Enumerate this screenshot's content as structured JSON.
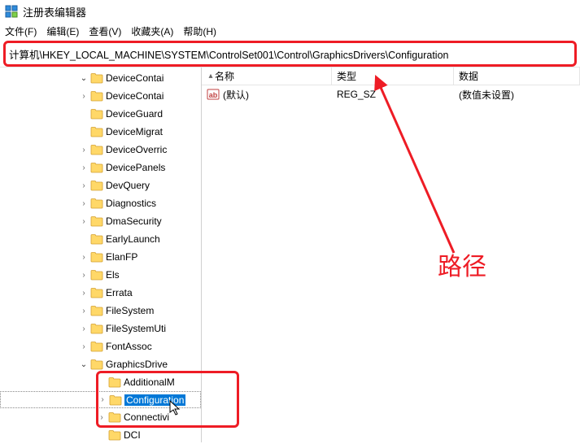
{
  "window": {
    "title": "注册表编辑器"
  },
  "menu": {
    "file": "文件(F)",
    "edit": "编辑(E)",
    "view": "查看(V)",
    "favorites": "收藏夹(A)",
    "help": "帮助(H)"
  },
  "address": "计算机\\HKEY_LOCAL_MACHINE\\SYSTEM\\ControlSet001\\Control\\GraphicsDrivers\\Configuration",
  "tree": [
    {
      "label": "DeviceContai",
      "expandable": true,
      "open": true,
      "indent": 1
    },
    {
      "label": "DeviceContai",
      "expandable": true,
      "open": false,
      "indent": 1
    },
    {
      "label": "DeviceGuard",
      "expandable": false,
      "open": false,
      "indent": 1
    },
    {
      "label": "DeviceMigrat",
      "expandable": false,
      "open": false,
      "indent": 1
    },
    {
      "label": "DeviceOverric",
      "expandable": true,
      "open": false,
      "indent": 1
    },
    {
      "label": "DevicePanels",
      "expandable": true,
      "open": false,
      "indent": 1
    },
    {
      "label": "DevQuery",
      "expandable": true,
      "open": false,
      "indent": 1
    },
    {
      "label": "Diagnostics",
      "expandable": true,
      "open": false,
      "indent": 1
    },
    {
      "label": "DmaSecurity",
      "expandable": true,
      "open": false,
      "indent": 1
    },
    {
      "label": "EarlyLaunch",
      "expandable": false,
      "open": false,
      "indent": 1
    },
    {
      "label": "ElanFP",
      "expandable": true,
      "open": false,
      "indent": 1
    },
    {
      "label": "Els",
      "expandable": true,
      "open": false,
      "indent": 1
    },
    {
      "label": "Errata",
      "expandable": true,
      "open": false,
      "indent": 1
    },
    {
      "label": "FileSystem",
      "expandable": true,
      "open": false,
      "indent": 1
    },
    {
      "label": "FileSystemUti",
      "expandable": true,
      "open": false,
      "indent": 1
    },
    {
      "label": "FontAssoc",
      "expandable": true,
      "open": false,
      "indent": 1
    },
    {
      "label": "GraphicsDrive",
      "expandable": true,
      "open": true,
      "indent": 1
    },
    {
      "label": "AdditionalM",
      "expandable": false,
      "open": false,
      "indent": 2
    },
    {
      "label": "Configuration",
      "expandable": true,
      "open": false,
      "indent": 2,
      "selected": true
    },
    {
      "label": "Connectivi",
      "expandable": true,
      "open": false,
      "indent": 2
    },
    {
      "label": "DCI",
      "expandable": false,
      "open": false,
      "indent": 2
    }
  ],
  "columns": {
    "name": "名称",
    "type": "类型",
    "data": "数据"
  },
  "values": [
    {
      "name": "(默认)",
      "type": "REG_SZ",
      "data": "(数值未设置)"
    }
  ],
  "annotation": {
    "label": "路径"
  }
}
